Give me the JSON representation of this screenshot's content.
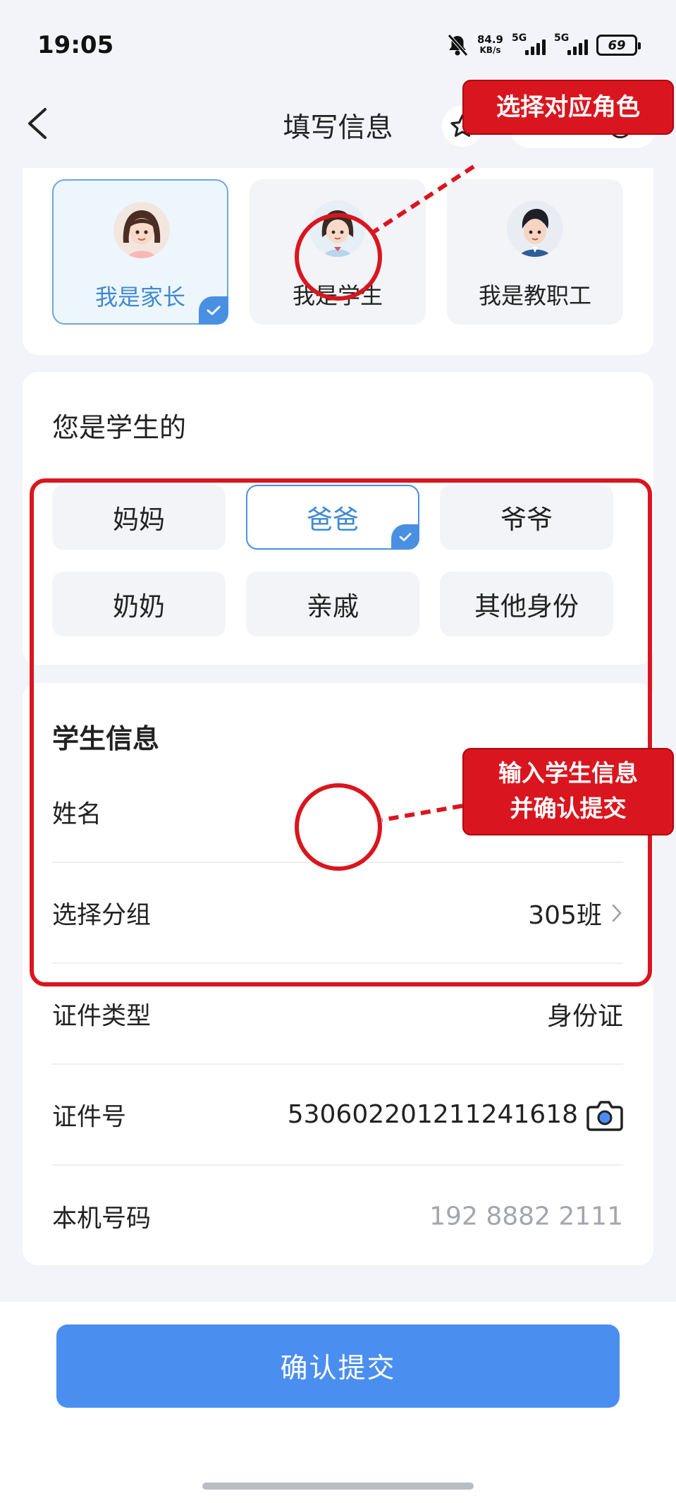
{
  "status_bar": {
    "time": "19:05",
    "net_speed_value": "84.9",
    "net_speed_unit": "KB/s",
    "signal_1_label": "5G",
    "signal_2_label": "5G",
    "battery": "69"
  },
  "nav": {
    "title": "填写信息"
  },
  "roles": [
    {
      "label": "我是家长",
      "selected": true
    },
    {
      "label": "我是学生",
      "selected": false
    },
    {
      "label": "我是教职工",
      "selected": false
    }
  ],
  "relation": {
    "title": "您是学生的",
    "options": [
      "妈妈",
      "爸爸",
      "爷爷",
      "奶奶",
      "亲戚",
      "其他身份"
    ],
    "selected": "爸爸"
  },
  "student_info": {
    "title": "学生信息",
    "fields": [
      {
        "label": "姓名",
        "value": ""
      },
      {
        "label": "选择分组",
        "value": "305班"
      },
      {
        "label": "证件类型",
        "value": "身份证"
      },
      {
        "label": "证件号",
        "value": "530602201211241618"
      },
      {
        "label": "本机号码",
        "value": "192 8882 2111"
      }
    ]
  },
  "submit_label": "确认提交",
  "annotations": {
    "callout_role": "选择对应角色",
    "callout_info_line1": "输入学生信息",
    "callout_info_line2": "并确认提交"
  },
  "colors": {
    "accent": "#4a8ef0",
    "selected_text": "#3d8ad2",
    "annotation_red": "#d9161f",
    "page_bg": "#f2f4f9"
  }
}
